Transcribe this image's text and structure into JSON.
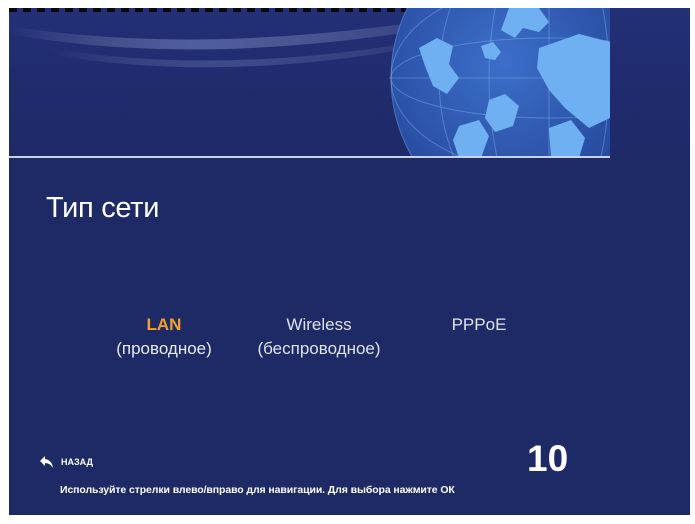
{
  "screen": {
    "title": "Тип сети",
    "options": [
      {
        "name": "LAN",
        "sub": "(проводное)",
        "selected": true
      },
      {
        "name": "Wireless",
        "sub": "(беспроводное)",
        "selected": false
      },
      {
        "name": "PPPoE",
        "sub": "",
        "selected": false
      }
    ],
    "footer": {
      "back_label": "НАЗАД",
      "back_icon": "back-arrow-icon",
      "counter": "10",
      "hint": "Используйте стрелки влево/вправо для навигации. Для выбора нажмите ОК"
    }
  },
  "colors": {
    "background": "#1d2a66",
    "selected": "#f3a02c",
    "text": "#ffffff",
    "globe": "#5a9ee6"
  }
}
